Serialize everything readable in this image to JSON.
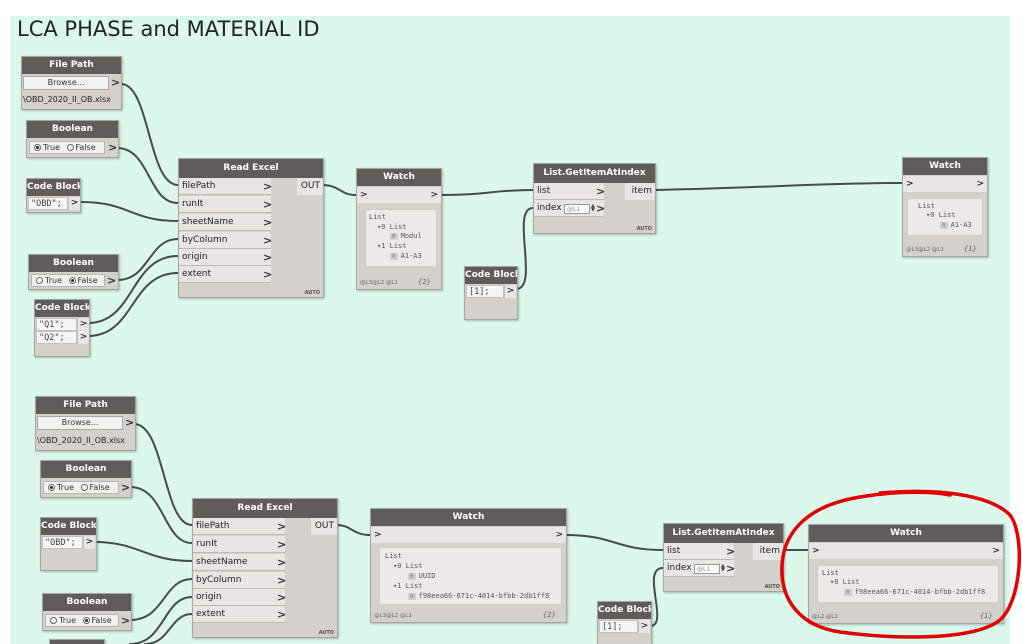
{
  "group": {
    "title": "LCA PHASE and MATERIAL ID",
    "background": "#dbf8ec"
  },
  "colors": {
    "node_header": "#5f5c59",
    "node_body": "#d4d1cc",
    "wire": "#4a4a4a",
    "highlight": "#e00000"
  },
  "top": {
    "file_path": {
      "title": "File Path",
      "button": "Browse...",
      "out": ">",
      "path": "\\OBD_2020_II_OB.xlsx"
    },
    "boolean1": {
      "title": "Boolean",
      "true_label": "True",
      "false_label": "False",
      "selected": "True",
      "out": ">"
    },
    "code_block1": {
      "title": "Code Block",
      "code": "\"OBD\";",
      "out": ">"
    },
    "boolean2": {
      "title": "Boolean",
      "true_label": "True",
      "false_label": "False",
      "selected": "False",
      "out": ">"
    },
    "code_block2": {
      "title": "Code Block",
      "line1": "\"Q1\";",
      "line2": "\"Q2\";",
      "out": ">"
    },
    "read_excel": {
      "title": "Read Excel",
      "inputs": [
        "filePath",
        "runIt",
        "sheetName",
        "byColumn",
        "origin",
        "extent"
      ],
      "output": "OUT",
      "auto": "AUTO"
    },
    "watch1": {
      "title": "Watch",
      "in": ">",
      "out": ">",
      "lines": {
        "l0": "List",
        "l1_idx": "0",
        "l1": "List",
        "l2_idx": "0",
        "l2": "Modul",
        "l3_idx": "1",
        "l3": "List",
        "l4_idx": "0",
        "l4": "A1-A3"
      },
      "levels": "@L3@L2 @L1",
      "count": "{2}"
    },
    "get_item": {
      "title": "List.GetItemAtIndex",
      "in1": "list",
      "in2": "index",
      "index_placeholder": "@L1",
      "out": "item",
      "auto": "AUTO"
    },
    "code_block3": {
      "title": "Code Block",
      "code": "[1];",
      "out": ">"
    },
    "watch2": {
      "title": "Watch",
      "in": ">",
      "out": ">",
      "lines": {
        "l0": "List",
        "l1_idx": "0",
        "l1": "List",
        "l2_idx": "0",
        "l2": "A1-A3"
      },
      "levels": "@L3@L2 @L1",
      "count": "{1}"
    }
  },
  "bottom": {
    "file_path": {
      "title": "File Path",
      "button": "Browse...",
      "out": ">",
      "path": "\\OBD_2020_II_OB.xlsx"
    },
    "boolean1": {
      "title": "Boolean",
      "true_label": "True",
      "false_label": "False",
      "selected": "True",
      "out": ">"
    },
    "code_block1": {
      "title": "Code Block",
      "code": "\"OBD\";",
      "out": ">"
    },
    "boolean2": {
      "title": "Boolean",
      "true_label": "True",
      "false_label": "False",
      "selected": "False",
      "out": ">"
    },
    "read_excel": {
      "title": "Read Excel",
      "inputs": [
        "filePath",
        "runIt",
        "sheetName",
        "byColumn",
        "origin",
        "extent"
      ],
      "output": "OUT",
      "auto": "AUTO"
    },
    "watch1": {
      "title": "Watch",
      "in": ">",
      "out": ">",
      "lines": {
        "l0": "List",
        "l1_idx": "0",
        "l1": "List",
        "l2_idx": "0",
        "l2": "UUID",
        "l3_idx": "1",
        "l3": "List",
        "l4_idx": "0",
        "l4": "f98eea66-671c-4014-bfbb-2db1ff8"
      },
      "levels": "@L3@L2 @L1",
      "count": "{2}"
    },
    "get_item": {
      "title": "List.GetItemAtIndex",
      "in1": "list",
      "in2": "index",
      "index_placeholder": "@L1",
      "out": "item",
      "auto": "AUTO"
    },
    "code_block3": {
      "title": "Code Block",
      "code": "[1];",
      "out": ">"
    },
    "watch2": {
      "title": "Watch",
      "in": ">",
      "out": ">",
      "lines": {
        "l0": "List",
        "l1_idx": "0",
        "l1": "List",
        "l2_idx": "0",
        "l2": "f98eea66-671c-4014-bfbb-2db1ff8"
      },
      "levels": "@L2 @L1",
      "count": "{1}"
    }
  }
}
